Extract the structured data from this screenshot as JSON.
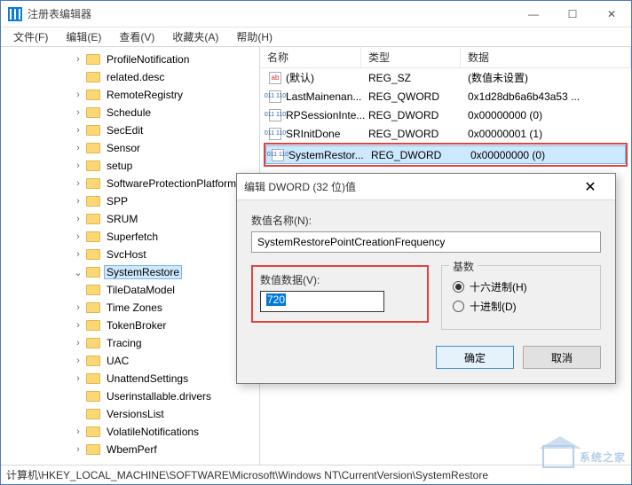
{
  "window": {
    "title": "注册表编辑器"
  },
  "menu": {
    "file": "文件(F)",
    "edit": "编辑(E)",
    "view": "查看(V)",
    "favorites": "收藏夹(A)",
    "help": "帮助(H)"
  },
  "tree": {
    "items": [
      {
        "label": "ProfileNotification",
        "expand": ">"
      },
      {
        "label": "related.desc",
        "expand": ""
      },
      {
        "label": "RemoteRegistry",
        "expand": ">"
      },
      {
        "label": "Schedule",
        "expand": ">"
      },
      {
        "label": "SecEdit",
        "expand": ">"
      },
      {
        "label": "Sensor",
        "expand": ">"
      },
      {
        "label": "setup",
        "expand": ">"
      },
      {
        "label": "SoftwareProtectionPlatform",
        "expand": ">"
      },
      {
        "label": "SPP",
        "expand": ">"
      },
      {
        "label": "SRUM",
        "expand": ">"
      },
      {
        "label": "Superfetch",
        "expand": ">"
      },
      {
        "label": "SvcHost",
        "expand": ">"
      },
      {
        "label": "SystemRestore",
        "expand": "v",
        "selected": true
      },
      {
        "label": "TileDataModel",
        "expand": ""
      },
      {
        "label": "Time Zones",
        "expand": ">"
      },
      {
        "label": "TokenBroker",
        "expand": ">"
      },
      {
        "label": "Tracing",
        "expand": ">"
      },
      {
        "label": "UAC",
        "expand": ">"
      },
      {
        "label": "UnattendSettings",
        "expand": ">"
      },
      {
        "label": "Userinstallable.drivers",
        "expand": ""
      },
      {
        "label": "VersionsList",
        "expand": ""
      },
      {
        "label": "VolatileNotifications",
        "expand": ">"
      },
      {
        "label": "WbemPerf",
        "expand": ">"
      }
    ]
  },
  "columns": {
    "name": "名称",
    "type": "类型",
    "data": "数据"
  },
  "values": [
    {
      "name": "(默认)",
      "type": "REG_SZ",
      "data": "(数值未设置)",
      "binicon": false
    },
    {
      "name": "LastMainenan...",
      "type": "REG_QWORD",
      "data": "0x1d28db6a6b43a53 ...",
      "binicon": true
    },
    {
      "name": "RPSessionInte...",
      "type": "REG_DWORD",
      "data": "0x00000000 (0)",
      "binicon": true
    },
    {
      "name": "SRInitDone",
      "type": "REG_DWORD",
      "data": "0x00000001 (1)",
      "binicon": true
    },
    {
      "name": "SystemRestor...",
      "type": "REG_DWORD",
      "data": "0x00000000 (0)",
      "binicon": true,
      "selected": true,
      "highlight": true
    }
  ],
  "dialog": {
    "title": "编辑 DWORD (32 位)值",
    "name_label": "数值名称(N):",
    "name_value": "SystemRestorePointCreationFrequency",
    "data_label": "数值数据(V):",
    "data_value": "720",
    "base_label": "基数",
    "radio_hex": "十六进制(H)",
    "radio_dec": "十进制(D)",
    "ok": "确定",
    "cancel": "取消"
  },
  "statusbar": "计算机\\HKEY_LOCAL_MACHINE\\SOFTWARE\\Microsoft\\Windows NT\\CurrentVersion\\SystemRestore",
  "watermark": "系统之家"
}
